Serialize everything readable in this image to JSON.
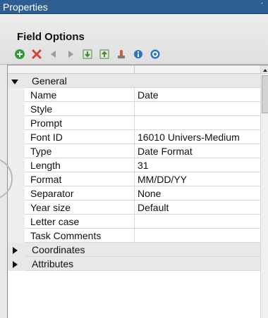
{
  "window": {
    "title": "Properties",
    "pin_glyph": "´"
  },
  "header": {
    "group_title": "Field Options"
  },
  "toolbar": {
    "buttons": [
      {
        "icon": "add-icon",
        "color": "#2e9c3c"
      },
      {
        "icon": "delete-icon",
        "color": "#d6432b"
      },
      {
        "icon": "arrow-left-icon",
        "color": "#9a9a9a"
      },
      {
        "icon": "arrow-right-icon",
        "color": "#9a9a9a"
      },
      {
        "icon": "import-icon",
        "color": "#3a8c2f"
      },
      {
        "icon": "export-icon",
        "color": "#3a8c2f"
      },
      {
        "icon": "stamp-icon",
        "color": "#d05b2b"
      },
      {
        "icon": "info-icon",
        "color": "#2b74c9"
      },
      {
        "icon": "help-icon",
        "color": "#2b74c9"
      }
    ]
  },
  "grid": {
    "categories": {
      "general": {
        "label": "General",
        "expanded": true
      },
      "coordinates": {
        "label": "Coordinates",
        "expanded": false
      },
      "attributes": {
        "label": "Attributes",
        "expanded": false
      }
    },
    "properties": [
      {
        "name": "Name",
        "value": "Date"
      },
      {
        "name": "Style",
        "value": ""
      },
      {
        "name": "Prompt",
        "value": ""
      },
      {
        "name": "Font ID",
        "value": "16010 Univers-Medium"
      },
      {
        "name": "Type",
        "value": "Date Format"
      },
      {
        "name": "Length",
        "value": "31"
      },
      {
        "name": "Format",
        "value": "MM/DD/YY"
      },
      {
        "name": "Separator",
        "value": "None"
      },
      {
        "name": "Year size",
        "value": "Default"
      },
      {
        "name": "Letter case",
        "value": ""
      },
      {
        "name": "Task Comments",
        "value": ""
      }
    ]
  },
  "colors": {
    "title_bar": "#2f5f92",
    "category_bg": "#e8e8e8",
    "grid_lines": "#d6d6d6"
  }
}
